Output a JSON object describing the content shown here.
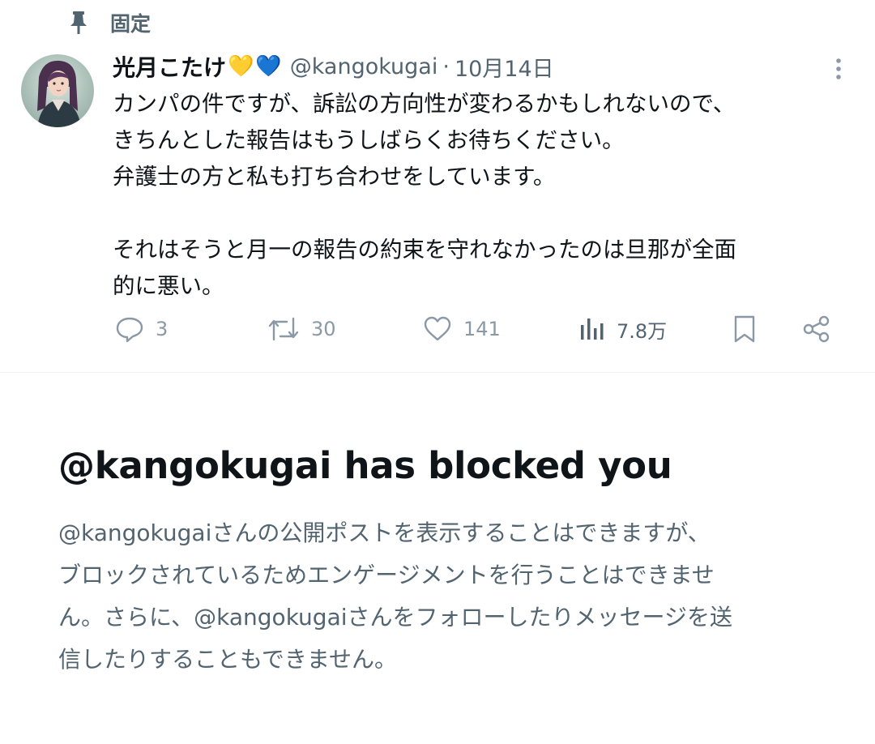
{
  "pinned": {
    "label": "固定",
    "icon": "pin-icon"
  },
  "tweet": {
    "display_name": "光月こたけ",
    "emoji_hearts": [
      "💛",
      "💙"
    ],
    "handle": "@kangokugai",
    "separator": "·",
    "timestamp": "10月14日",
    "body_lines": [
      "カンパの件ですが、訴訟の方向性が変わるかもしれないので、",
      "きちんとした報告はもうしばらくお待ちください。",
      "弁護士の方と私も打ち合わせをしています。",
      "",
      "それはそうと月一の報告の約束を守れなかったのは旦那が全面",
      "的に悪い。"
    ],
    "actions": {
      "reply_count": "3",
      "retweet_count": "30",
      "like_count": "141",
      "views_count": "7.8万"
    }
  },
  "blocked": {
    "title": "@kangokugai has blocked you",
    "description_lines": [
      "@kangokugaiさんの公開ポストを表示することはできますが、",
      "ブロックされているためエンゲージメントを行うことはできませ",
      "ん。さらに、@kangokugaiさんをフォローしたりメッセージを送",
      "信したりすることもできません。"
    ]
  },
  "colors": {
    "text_primary": "#0f1419",
    "text_secondary": "#536471",
    "icon_muted": "#8b98a5",
    "divider": "#eff3f4"
  }
}
